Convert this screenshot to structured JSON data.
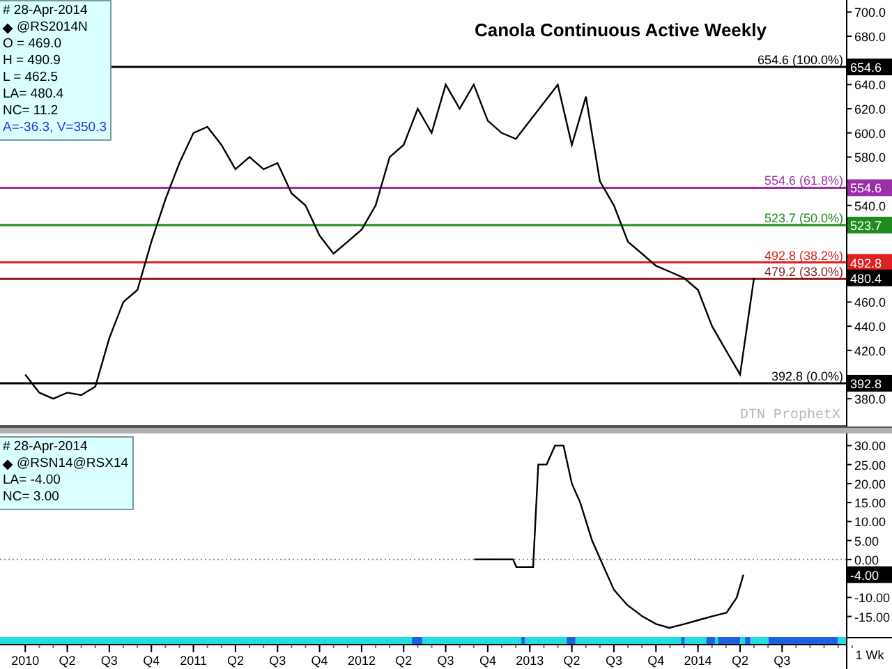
{
  "upper_chart": {
    "title": "Canola Continuous Active Weekly",
    "legend": {
      "date": "# 28-Apr-2014",
      "symbol": "@RS2014N",
      "lines": [
        "O = 469.0",
        "H = 490.9",
        "L = 462.5",
        "LA= 480.4",
        "NC= 11.2"
      ],
      "footer": "A=-36.3, V=350.3"
    },
    "source_mark": "DTN ProphetX",
    "axis_badges": [
      {
        "kind": "level",
        "text": "654.6",
        "color": "#000000"
      },
      {
        "kind": "level",
        "text": "554.6",
        "color": "#9b2fa8"
      },
      {
        "kind": "level",
        "text": "523.7",
        "color": "#1e8c1e"
      },
      {
        "kind": "level",
        "text": "492.8",
        "color": "#e02020"
      },
      {
        "kind": "last",
        "text": "480.4",
        "color": "#000000"
      },
      {
        "kind": "level",
        "text": "392.8",
        "color": "#000000"
      }
    ],
    "chart_data": {
      "type": "line",
      "ylim": [
        357,
        710
      ],
      "yticks": [
        {
          "value": 380,
          "label": "380.0"
        },
        {
          "value": 420,
          "label": "420.0"
        },
        {
          "value": 440,
          "label": "440.0"
        },
        {
          "value": 460,
          "label": "460.0"
        },
        {
          "value": 540,
          "label": "540.0"
        },
        {
          "value": 580,
          "label": "580.0"
        },
        {
          "value": 600,
          "label": "600.0"
        },
        {
          "value": 620,
          "label": "620.0"
        },
        {
          "value": 640,
          "label": "640.0"
        },
        {
          "value": 680,
          "label": "680.0"
        },
        {
          "value": 700,
          "label": "700.0"
        }
      ],
      "series": [
        {
          "color": "#000000",
          "values": [
            400,
            385,
            380,
            385,
            383,
            390,
            430,
            460,
            470,
            510,
            545,
            575,
            600,
            605,
            590,
            570,
            580,
            570,
            575,
            550,
            540,
            515,
            500,
            510,
            520,
            540,
            580,
            590,
            620,
            600,
            640,
            620,
            640,
            610,
            600,
            595,
            610,
            625,
            640,
            590,
            630,
            560,
            540,
            510,
            500,
            490,
            485,
            480,
            470,
            440,
            420,
            400,
            480
          ]
        }
      ],
      "ref_lines": [
        {
          "axis": "y",
          "value": 654.6,
          "label": "654.6 (100.0%)",
          "color": "#000000"
        },
        {
          "axis": "y",
          "value": 554.6,
          "label": "554.6 (61.8%)",
          "color": "#9b2fa8"
        },
        {
          "axis": "y",
          "value": 523.7,
          "label": "523.7 (50.0%)",
          "color": "#1e8c1e"
        },
        {
          "axis": "y",
          "value": 492.8,
          "label": "492.8 (38.2%)",
          "color": "#e02020"
        },
        {
          "axis": "y",
          "value": 479.2,
          "label": "479.2 (33.0%)",
          "color": "#8b1a1a"
        },
        {
          "axis": "y",
          "value": 392.8,
          "label": "392.8 (0.0%)",
          "color": "#000000"
        }
      ]
    }
  },
  "lower_chart": {
    "legend": {
      "date": "# 28-Apr-2014",
      "lines": [
        "LA= -4.00",
        "NC= 3.00"
      ]
    },
    "last_value_badge": "-4.00",
    "chart_data": {
      "type": "line",
      "xlim": [
        2009.85,
        2014.88
      ],
      "ylim": [
        -20.4,
        33.2
      ],
      "yticks": [
        {
          "value": 30,
          "label": "30.00"
        },
        {
          "value": 25,
          "label": "25.00"
        },
        {
          "value": 20,
          "label": "20.00"
        },
        {
          "value": 15,
          "label": "15.00"
        },
        {
          "value": 10,
          "label": "10.00"
        },
        {
          "value": 5,
          "label": "5.00"
        },
        {
          "value": 0,
          "label": "0.00"
        },
        {
          "value": -10,
          "label": "-10.00"
        },
        {
          "value": -15,
          "label": "-15.00"
        }
      ],
      "xticks": [
        {
          "value": 2010,
          "label": "2010"
        },
        {
          "value": 2010.25,
          "label": "Q2"
        },
        {
          "value": 2010.5,
          "label": "Q3"
        },
        {
          "value": 2010.75,
          "label": "Q4"
        },
        {
          "value": 2011,
          "label": "2011"
        },
        {
          "value": 2011.25,
          "label": "Q2"
        },
        {
          "value": 2011.5,
          "label": "Q3"
        },
        {
          "value": 2011.75,
          "label": "Q4"
        },
        {
          "value": 2012,
          "label": "2012"
        },
        {
          "value": 2012.25,
          "label": "Q2"
        },
        {
          "value": 2012.5,
          "label": "Q3"
        },
        {
          "value": 2012.75,
          "label": "Q4"
        },
        {
          "value": 2013,
          "label": "2013"
        },
        {
          "value": 2013.25,
          "label": "Q2"
        },
        {
          "value": 2013.5,
          "label": "Q3"
        },
        {
          "value": 2013.75,
          "label": "Q4"
        },
        {
          "value": 2014,
          "label": "2014"
        },
        {
          "value": 2014.25,
          "label": "Q2"
        },
        {
          "value": 2014.5,
          "label": "Q3"
        }
      ],
      "x": [
        2012.67,
        2012.9,
        2012.92,
        2013.02,
        2013.05,
        2013.1,
        2013.15,
        2013.2,
        2013.25,
        2013.3,
        2013.37,
        2013.42,
        2013.5,
        2013.58,
        2013.67,
        2013.75,
        2013.83,
        2013.92,
        2014.0,
        2014.08,
        2014.17,
        2014.23,
        2014.27
      ],
      "series": [
        {
          "name": "@RSN14@RSX14",
          "color": "#000000",
          "values": [
            0,
            0,
            -2,
            -2,
            25,
            25,
            30,
            30,
            20,
            15,
            5,
            0,
            -8,
            -12,
            -15,
            -17,
            -18,
            -17,
            -16,
            -15,
            -14,
            -10,
            -4
          ]
        }
      ]
    }
  },
  "interval": "1 Wk"
}
